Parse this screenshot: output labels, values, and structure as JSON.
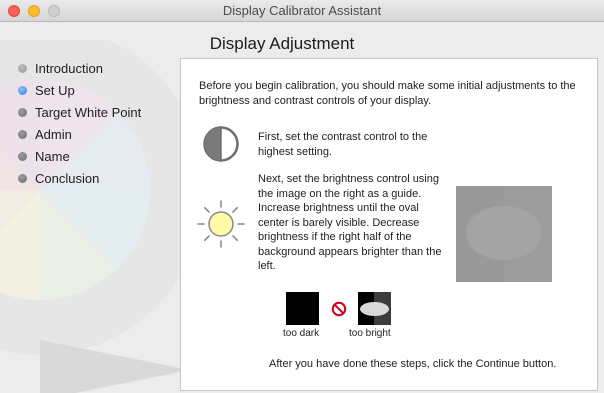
{
  "window": {
    "title": "Display Calibrator Assistant"
  },
  "sidebar": {
    "steps": [
      {
        "label": "Introduction",
        "state": "done"
      },
      {
        "label": "Set Up",
        "state": "current"
      },
      {
        "label": "Target White Point",
        "state": "pending"
      },
      {
        "label": "Admin",
        "state": "pending"
      },
      {
        "label": "Name",
        "state": "pending"
      },
      {
        "label": "Conclusion",
        "state": "pending"
      }
    ]
  },
  "main": {
    "title": "Display Adjustment",
    "intro_text": "Before you begin calibration, you should make some initial adjustments to the brightness and contrast controls of your display.",
    "contrast_text": "First, set the contrast control to the highest setting.",
    "brightness_text": "Next, set the brightness control using the image on the right as a guide.  Increase brightness until the oval center is barely visible. Decrease brightness if the right half of the background appears brighter than the left.",
    "sample_dark_caption": "too dark",
    "sample_bright_caption": "too bright",
    "footer_text": "After you have done these steps, click the Continue button."
  },
  "icons": {
    "contrast": "contrast-icon",
    "brightness": "brightness-sun-icon",
    "prohibited": "no-sign-icon"
  },
  "colors": {
    "current_step": "#2e7cf0",
    "close": "#fc5f57",
    "minimize": "#fdbc2e",
    "prohibit": "#d0021b",
    "sun": "#fff9a8"
  }
}
